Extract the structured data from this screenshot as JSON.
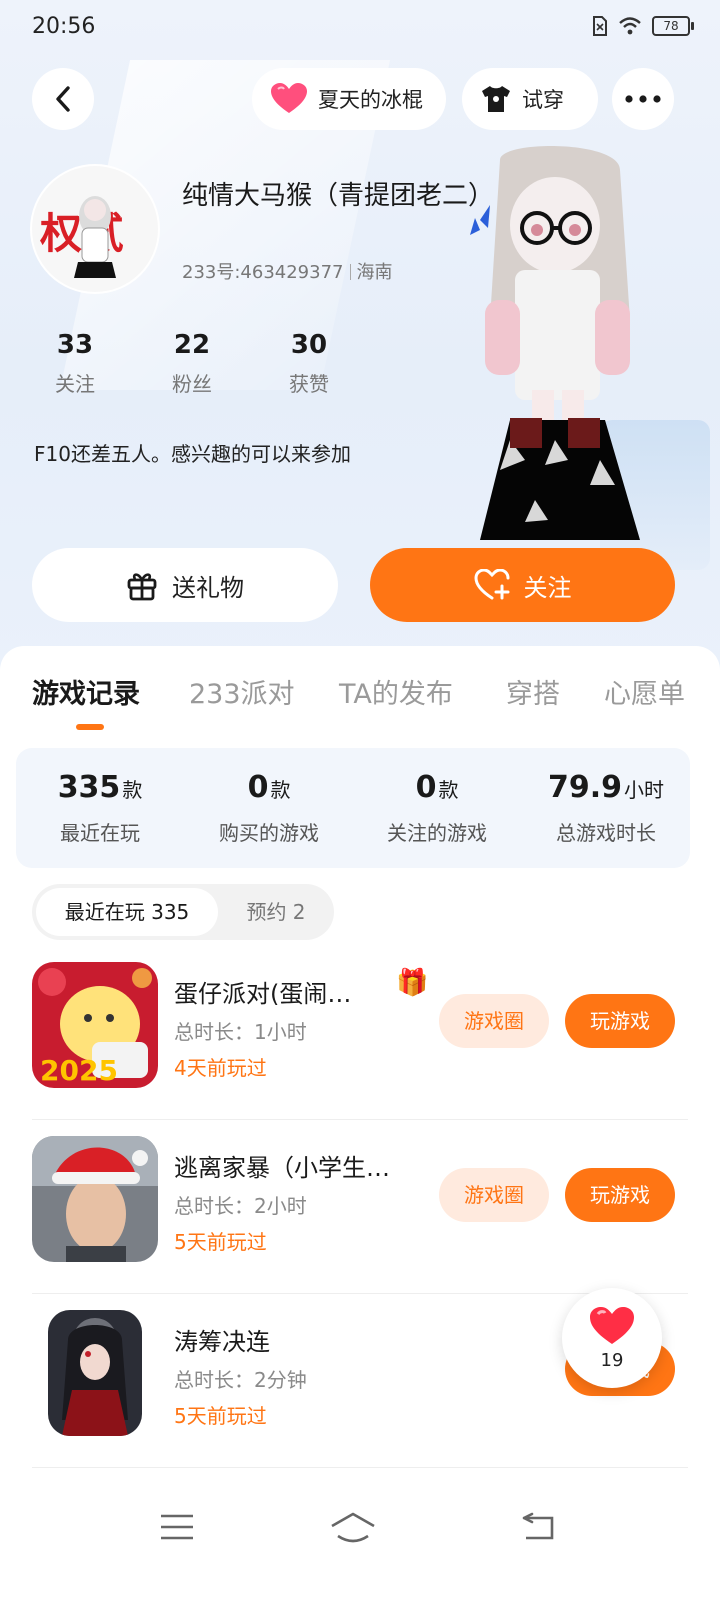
{
  "status_bar": {
    "time": "20:56",
    "battery": "78"
  },
  "header": {
    "ice_label": "夏天的冰棍",
    "try_label": "试穿"
  },
  "profile": {
    "name": "纯情大马猴（青提团老二）",
    "uid": "233号:463429377",
    "region": "海南",
    "avatar_text": "权贰",
    "stats": [
      {
        "num": "33",
        "label": "关注"
      },
      {
        "num": "22",
        "label": "粉丝"
      },
      {
        "num": "30",
        "label": "获赞"
      }
    ],
    "bio": "F10还差五人。感兴趣的可以来参加"
  },
  "actions": {
    "gift_label": "送礼物",
    "follow_label": "关注"
  },
  "tabs": [
    {
      "label": "游戏记录",
      "active": true
    },
    {
      "label": "233派对"
    },
    {
      "label": "TA的发布"
    },
    {
      "label": "穿搭"
    },
    {
      "label": "心愿单"
    }
  ],
  "summary": [
    {
      "value": "335",
      "unit": "款",
      "label": "最近在玩"
    },
    {
      "value": "0",
      "unit": "款",
      "label": "购买的游戏"
    },
    {
      "value": "0",
      "unit": "款",
      "label": "关注的游戏"
    },
    {
      "value": "79.9",
      "unit": "小时",
      "label": "总游戏时长"
    }
  ],
  "segments": {
    "recent": "最近在玩 335",
    "reserve": "预约 2"
  },
  "games": [
    {
      "title": "蛋仔派对(蛋闹…",
      "duration": "总时长：1小时",
      "last": "4天前玩过",
      "circle": "游戏圈",
      "play": "玩游戏"
    },
    {
      "title": "逃离家暴（小学生…",
      "duration": "总时长：2小时",
      "last": "5天前玩过",
      "circle": "游戏圈",
      "play": "玩游戏"
    },
    {
      "title": "涛筹决连",
      "duration": "总时长：2分钟",
      "last": "5天前玩过",
      "play": "玩游戏"
    }
  ],
  "float_like": {
    "count": "19"
  },
  "colors": {
    "accent": "#ff7514",
    "accent_light": "#ffeade"
  }
}
